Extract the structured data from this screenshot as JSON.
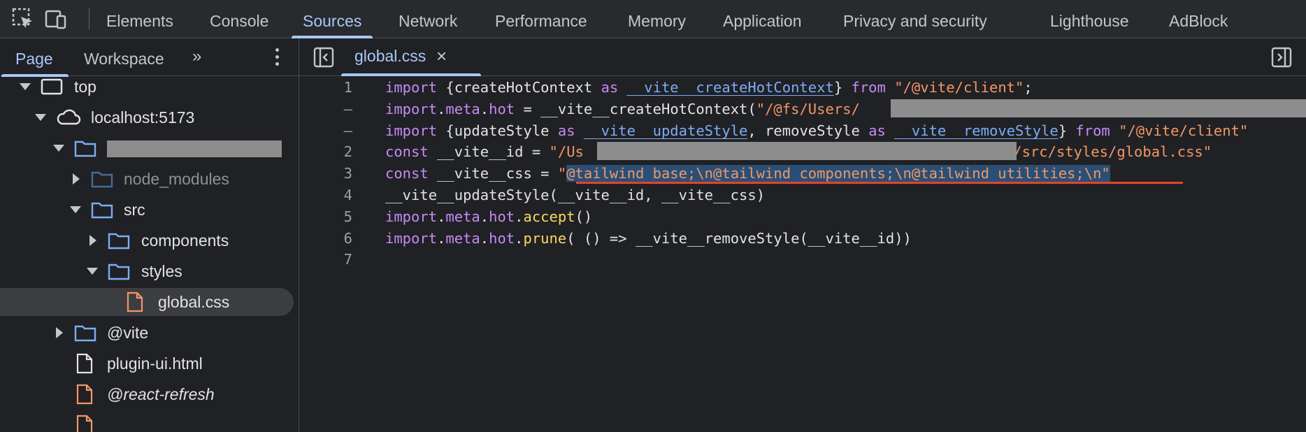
{
  "toolbar": {
    "tabs": [
      "Elements",
      "Console",
      "Sources",
      "Network",
      "Performance",
      "Memory",
      "Application",
      "Privacy and security",
      "Lighthouse",
      "AdBlock"
    ],
    "active_tab": "Sources",
    "accent_color": "#a8c7fa"
  },
  "navigator": {
    "tabs": [
      "Page",
      "Workspace"
    ],
    "more_label": "»",
    "tree": [
      {
        "label": "top",
        "icon": "frame-icon",
        "expanded": true
      },
      {
        "label": "localhost:5173",
        "icon": "cloud-icon",
        "expanded": true
      },
      {
        "label": "",
        "icon": "folder-icon",
        "expanded": true,
        "redacted": true
      },
      {
        "label": "node_modules",
        "icon": "folder-icon",
        "expanded": false,
        "dimmed": true
      },
      {
        "label": "src",
        "icon": "folder-icon",
        "expanded": true
      },
      {
        "label": "components",
        "icon": "folder-icon",
        "expanded": false
      },
      {
        "label": "styles",
        "icon": "folder-icon",
        "expanded": true
      },
      {
        "label": "global.css",
        "icon": "file-icon",
        "selected": true
      },
      {
        "label": "@vite",
        "icon": "folder-icon",
        "expanded": false
      },
      {
        "label": "plugin-ui.html",
        "icon": "file-icon"
      },
      {
        "label": "@react-refresh",
        "icon": "file-icon",
        "italic": true
      }
    ]
  },
  "editor": {
    "tab_label": "global.css",
    "close_glyph": "×",
    "line_numbers": [
      "1",
      "–",
      "–",
      "2",
      "3",
      "4",
      "5",
      "6",
      "7"
    ],
    "lines": {
      "l1": {
        "a": "import",
        "b": " {createHotContext ",
        "c": "as",
        "d": "__vite__createHotContext",
        "e": "} ",
        "f": "from",
        "g": "\"/@vite/client\"",
        "h": ";"
      },
      "l2": {
        "a": "import",
        "b": ".",
        "c": "meta",
        "d": ".",
        "e": "hot",
        "f": " = __vite__createHotContext(",
        "g": "\"/@fs/Users/"
      },
      "l3": {
        "a": "import",
        "b": " {updateStyle ",
        "c": "as",
        "d": "__vite__updateStyle",
        "e": ", removeStyle ",
        "f": "as",
        "g": "__vite__removeStyle",
        "h": "} ",
        "i": "from",
        "j": "\"/@vite/client\""
      },
      "l4": {
        "a": "const",
        "b": " __vite__id = ",
        "c": "\"/Us",
        "d": "d/src/styles/global.css\""
      },
      "l5": {
        "a": "const",
        "b": " __vite__css = ",
        "c": "\"",
        "d": "@tailwind base;\\n@tailwind components;\\n@tailwind utilities;\\n\""
      },
      "l6": {
        "a": "__vite__updateStyle(__vite__id, __vite__css)"
      },
      "l7": {
        "a": "import",
        "b": ".",
        "c": "meta",
        "d": ".",
        "e": "hot",
        "f": ".",
        "g": "accept",
        "h": "()"
      },
      "l8": {
        "a": "import",
        "b": ".",
        "c": "meta",
        "d": ".",
        "e": "hot",
        "f": ".",
        "g": "prune",
        "h": "( () => __vite__removeStyle(__vite__id))"
      }
    }
  }
}
